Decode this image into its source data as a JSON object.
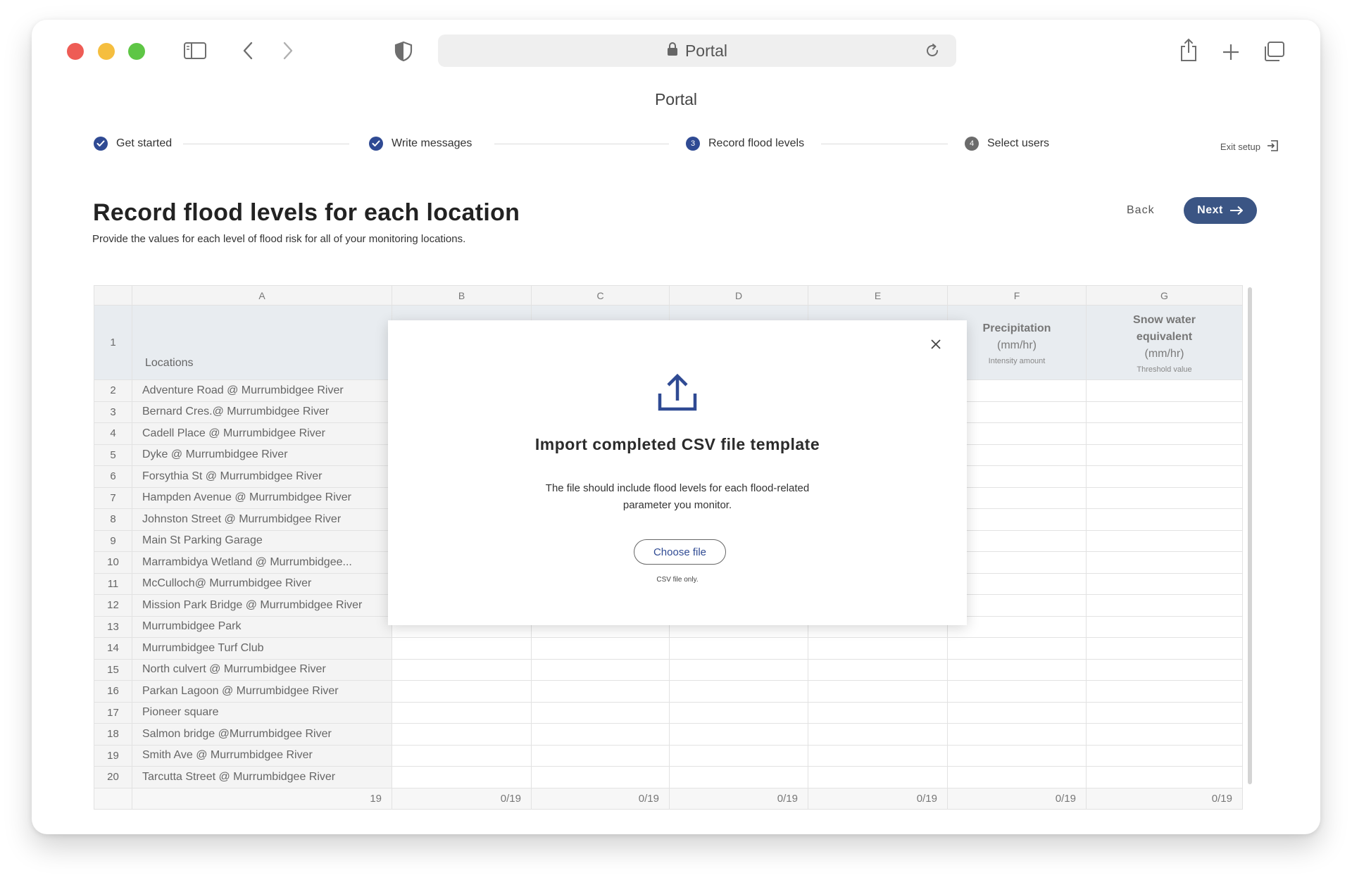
{
  "browser": {
    "address_text": "Portal",
    "icons": [
      "sidebar-icon",
      "back-icon",
      "forward-icon",
      "shield-icon",
      "lock-icon",
      "reload-icon",
      "share-icon",
      "new-tab-icon",
      "tabs-icon"
    ]
  },
  "page": {
    "title": "Portal"
  },
  "stepper": {
    "steps": [
      {
        "label": "Get started",
        "status": "complete"
      },
      {
        "label": "Write messages",
        "status": "complete"
      },
      {
        "number": "3",
        "label": "Record flood levels",
        "status": "current"
      },
      {
        "number": "4",
        "label": "Select users",
        "status": "upcoming"
      }
    ],
    "exit_label": "Exit setup"
  },
  "header": {
    "title": "Record flood levels for each location",
    "subtitle": "Provide the values for each level of flood risk for all of your monitoring locations.",
    "back_label": "Back",
    "next_label": "Next"
  },
  "sheet": {
    "column_letters": [
      "A",
      "B",
      "C",
      "D",
      "E",
      "F",
      "G"
    ],
    "header_row_number": "1",
    "columns": {
      "locations": "Locations",
      "f_title": "Precipitation",
      "f_unit": "(mm/hr)",
      "f_note": "Intensity amount",
      "g_title_1": "Snow water",
      "g_title_2": "equivalent",
      "g_unit": "(mm/hr)",
      "g_note": "Threshold value"
    },
    "rows": [
      {
        "num": "2",
        "location": "Adventure Road @ Murrumbidgee River"
      },
      {
        "num": "3",
        "location": "Bernard Cres.@ Murrumbidgee River"
      },
      {
        "num": "4",
        "location": "Cadell Place @ Murrumbidgee River"
      },
      {
        "num": "5",
        "location": "Dyke @ Murrumbidgee River"
      },
      {
        "num": "6",
        "location": "Forsythia St @ Murrumbidgee River"
      },
      {
        "num": "7",
        "location": "Hampden Avenue @ Murrumbidgee River"
      },
      {
        "num": "8",
        "location": "Johnston Street @ Murrumbidgee River"
      },
      {
        "num": "9",
        "location": "Main St Parking Garage"
      },
      {
        "num": "10",
        "location": "Marrambidya Wetland @ Murrumbidgee..."
      },
      {
        "num": "11",
        "location": "McCulloch@ Murrumbidgee River"
      },
      {
        "num": "12",
        "location": "Mission Park Bridge @ Murrumbidgee River"
      },
      {
        "num": "13",
        "location": "Murrumbidgee Park"
      },
      {
        "num": "14",
        "location": "Murrumbidgee Turf Club"
      },
      {
        "num": "15",
        "location": "North culvert @ Murrumbidgee River"
      },
      {
        "num": "16",
        "location": "Parkan Lagoon @ Murrumbidgee River"
      },
      {
        "num": "17",
        "location": "Pioneer square"
      },
      {
        "num": "18",
        "location": "Salmon bridge @Murrumbidgee River"
      },
      {
        "num": "19",
        "location": "Smith Ave @ Murrumbidgee River"
      },
      {
        "num": "20",
        "location": "Tarcutta Street @ Murrumbidgee River"
      }
    ],
    "footer": [
      "19",
      "0/19",
      "0/19",
      "0/19",
      "0/19",
      "0/19",
      "0/19"
    ]
  },
  "modal": {
    "title": "Import completed CSV file template",
    "description_line1": "The file should include flood levels for each flood-related",
    "description_line2": "parameter you monitor.",
    "button_label": "Choose file",
    "note": "CSV file only.",
    "icons": [
      "upload-icon",
      "close-icon"
    ]
  },
  "colors": {
    "accent": "#2f4a93",
    "next_button": "#3b5584",
    "header_cell": "#e8ecf0",
    "row_label_bg": "#f4f4f4"
  }
}
